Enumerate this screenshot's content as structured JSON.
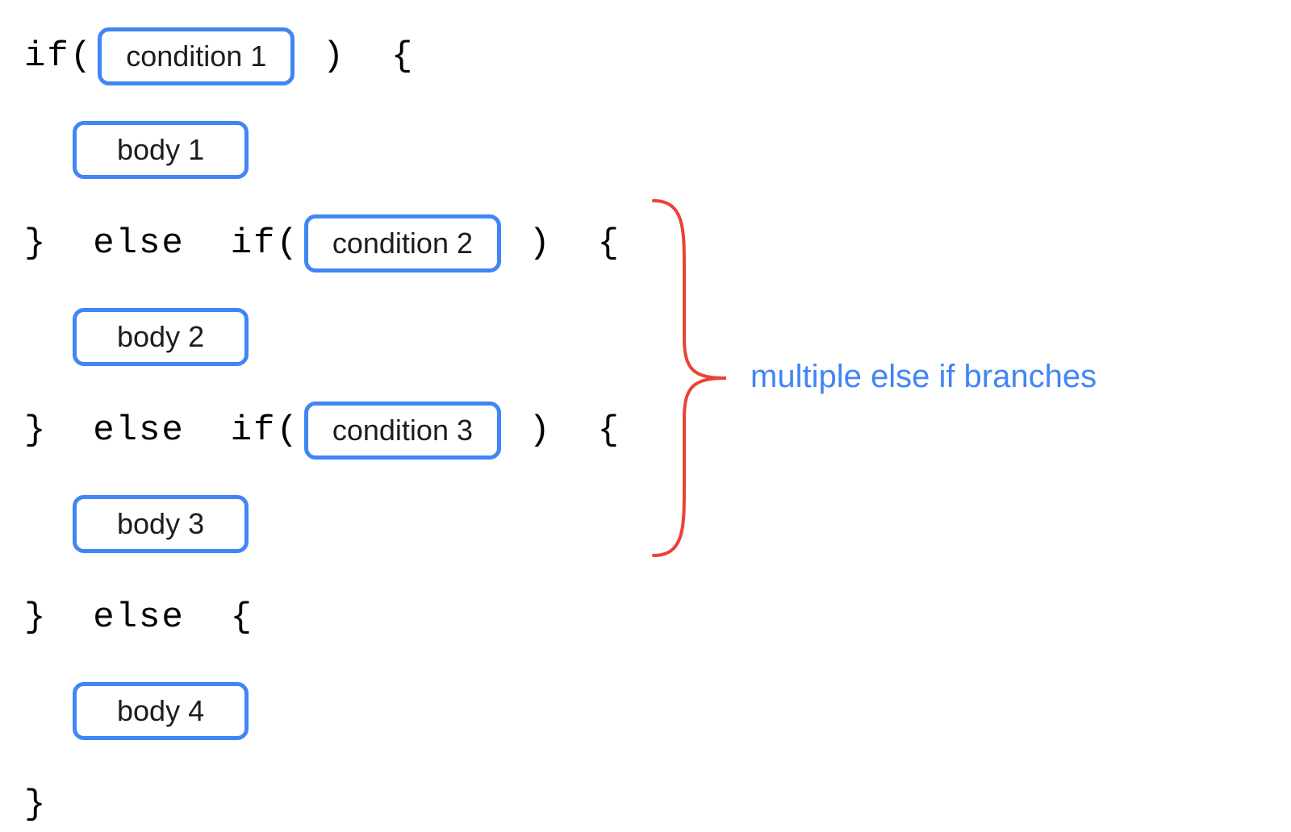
{
  "code": {
    "if": "if(",
    "close_paren_brace": " )  {",
    "else_if": "}  else  if(",
    "else": "}  else  {",
    "close_brace": "}"
  },
  "boxes": {
    "condition1": "condition 1",
    "condition2": "condition 2",
    "condition3": "condition 3",
    "body1": "body 1",
    "body2": "body 2",
    "body3": "body 3",
    "body4": "body 4"
  },
  "annotation": {
    "label": "multiple else if branches"
  },
  "colors": {
    "box_border": "#4285f4",
    "brace": "#ea4335",
    "text": "#000000",
    "annotation_text": "#4285f4"
  }
}
